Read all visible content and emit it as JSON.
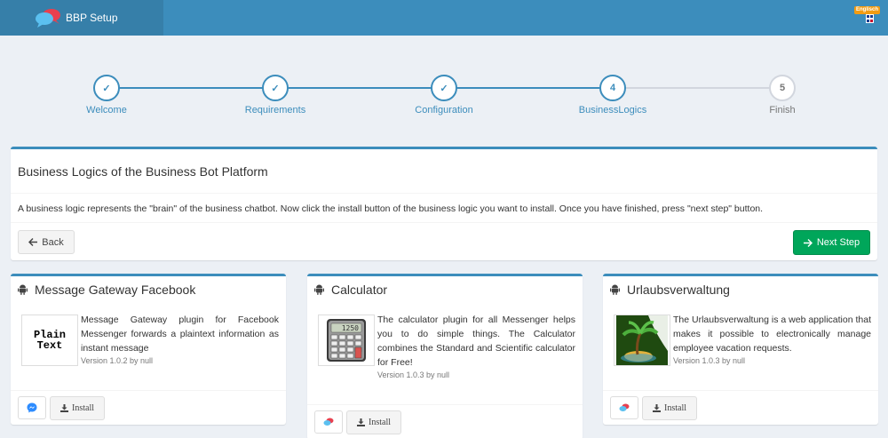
{
  "app": {
    "title": "BBP Setup"
  },
  "language": {
    "badge": "Englisch"
  },
  "wizard": {
    "steps": [
      {
        "mark": "✓",
        "label": "Welcome"
      },
      {
        "mark": "✓",
        "label": "Requirements"
      },
      {
        "mark": "✓",
        "label": "Configuration"
      },
      {
        "mark": "4",
        "label": "BusinessLogics"
      },
      {
        "mark": "5",
        "label": "Finish"
      }
    ]
  },
  "main": {
    "title": "Business Logics of the Business Bot Platform",
    "description": "A business logic represents the \"brain\" of the business chatbot. Now click the install button of the business logic you want to install. Once you have finished, press \"next step\" button.",
    "back_label": "Back",
    "next_label": "Next Step"
  },
  "cards": [
    {
      "title": "Message Gateway Facebook",
      "image_text": "Plain\nText",
      "description": "Message Gateway plugin for Facebook Messenger forwards a plaintext information as instant message",
      "version": "Version 1.0.2 by null",
      "install_label": "Install",
      "messenger_icon": "facebook-messenger-icon"
    },
    {
      "title": "Calculator",
      "image_text": "1250",
      "description": "The calculator plugin for all Messenger helps you to do simple things. The Calculator combines the Standard and Scientific calculator for Free!",
      "version": "Version 1.0.3 by null",
      "install_label": "Install",
      "messenger_icon": "messenger-icon"
    },
    {
      "title": "Urlaubsverwaltung",
      "description": "The Urlaubsverwaltung is a web application that makes it possible to electronically manage employee vacation requests.",
      "version": "Version 1.0.3 by null",
      "install_label": "Install",
      "messenger_icon": "messenger-icon"
    }
  ],
  "colors": {
    "primary": "#3c8dbc",
    "primary_dark": "#367fa9",
    "success": "#00a65a",
    "background": "#ecf0f5",
    "badge": "#f39c12"
  }
}
